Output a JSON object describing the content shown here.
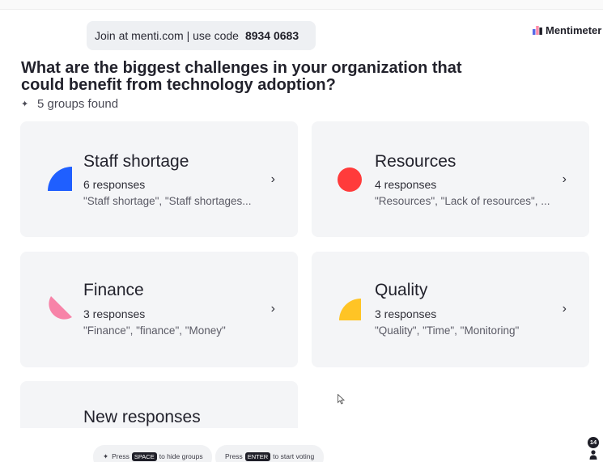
{
  "join": {
    "text": "Join at menti.com | use code",
    "code": "8934 0683"
  },
  "brand": {
    "name": "Mentimeter"
  },
  "question": "What are the biggest challenges in your organization that could benefit from technology adoption?",
  "groups_found": "5 groups found",
  "cards": [
    {
      "title": "Staff shortage",
      "count": "6 responses",
      "samples": "\"Staff shortage\", \"Staff shortages...",
      "shape": "quarter-circle",
      "color": "#1f5fff"
    },
    {
      "title": "Resources",
      "count": "4 responses",
      "samples": "\"Resources\", \"Lack of resources\", ...",
      "shape": "circle",
      "color": "#ff3b3b"
    },
    {
      "title": "Finance",
      "count": "3 responses",
      "samples": "\"Finance\", \"finance\", \"Money\"",
      "shape": "semicircle",
      "color": "#f783a8"
    },
    {
      "title": "Quality",
      "count": "3 responses",
      "samples": "\"Quality\", \"Time\", \"Monitoring\"",
      "shape": "semicircle-top",
      "color": "#ffc425"
    },
    {
      "title": "New responses"
    }
  ],
  "footer": {
    "hide_groups": {
      "press": "Press",
      "key": "SPACE",
      "action": "to hide groups"
    },
    "start_voting": {
      "press": "Press",
      "key": "ENTER",
      "action": "to start voting"
    }
  },
  "participants": {
    "count": "14",
    "icon": "person-icon"
  },
  "icons": {
    "chevron": "›",
    "sparkle": "✦"
  }
}
